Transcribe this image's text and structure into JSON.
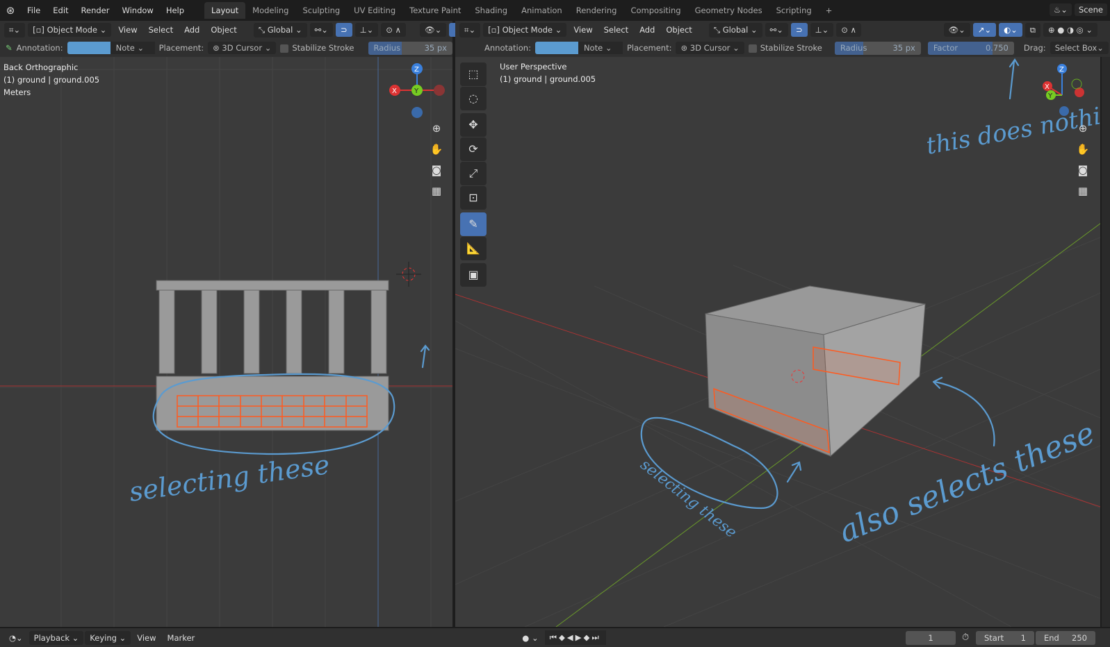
{
  "menu": [
    "File",
    "Edit",
    "Render",
    "Window",
    "Help"
  ],
  "workspaces": [
    "Layout",
    "Modeling",
    "Sculpting",
    "UV Editing",
    "Texture Paint",
    "Shading",
    "Animation",
    "Rendering",
    "Compositing",
    "Geometry Nodes",
    "Scripting",
    "+"
  ],
  "scene": "Scene",
  "header": {
    "mode": "Object Mode",
    "view": "View",
    "select": "Select",
    "add": "Add",
    "object": "Object",
    "orientation": "Global"
  },
  "toolsettings": {
    "annotation_label": "Annotation:",
    "note": "Note",
    "placement_label": "Placement:",
    "placement": "3D Cursor",
    "stabilize": "Stabilize Stroke",
    "radius_label": "Radius",
    "radius_value": "35 px",
    "factor_label": "Factor",
    "factor_value": "0.750",
    "drag_label": "Drag:",
    "drag_value": "Select Box"
  },
  "left_viewport": {
    "view": "Back Orthographic",
    "object": "(1) ground | ground.005",
    "units": "Meters"
  },
  "right_viewport": {
    "view": "User Perspective",
    "object": "(1) ground | ground.005"
  },
  "annotations": {
    "left": "selecting these",
    "right1": "selecting these",
    "right2": "also selects these",
    "right3": "this does nothing"
  },
  "timeline": {
    "playback": "Playback",
    "keying": "Keying",
    "view": "View",
    "marker": "Marker",
    "frame": "1",
    "start_label": "Start",
    "start": "1",
    "end_label": "End",
    "end": "250"
  },
  "colors": {
    "accent": "#4772b3",
    "annotation": "#5b9bd0",
    "selection": "#ff5a1f"
  }
}
